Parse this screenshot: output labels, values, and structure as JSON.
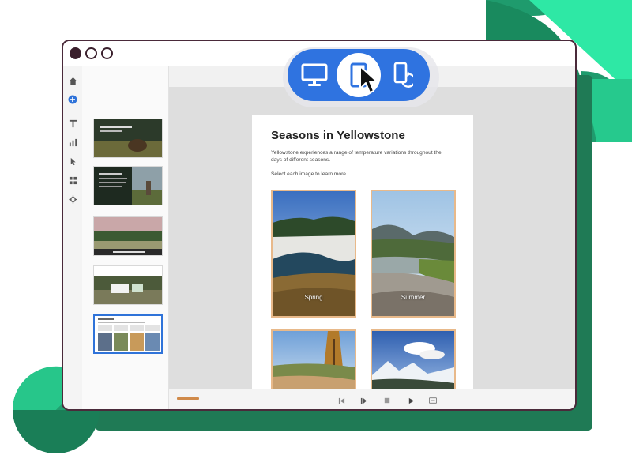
{
  "slide": {
    "title": "Seasons in Yellowstone",
    "description": "Yellowstone experiences a range of temperature variations throughout the days of different seasons.",
    "prompt": "Select each image to learn more.",
    "cards": [
      {
        "label": "Spring"
      },
      {
        "label": "Summer"
      },
      {
        "label": ""
      },
      {
        "label": ""
      }
    ]
  },
  "device_switcher": {
    "options": [
      "desktop-icon",
      "tablet-icon",
      "mobile-rotate-icon"
    ],
    "active": "tablet-icon"
  },
  "colors": {
    "accent": "#2f73e0",
    "card_border": "#e8b98a",
    "window_border": "#4a2a3a",
    "brand_green": "#1f7a55",
    "bright_green": "#2ee8a5"
  }
}
